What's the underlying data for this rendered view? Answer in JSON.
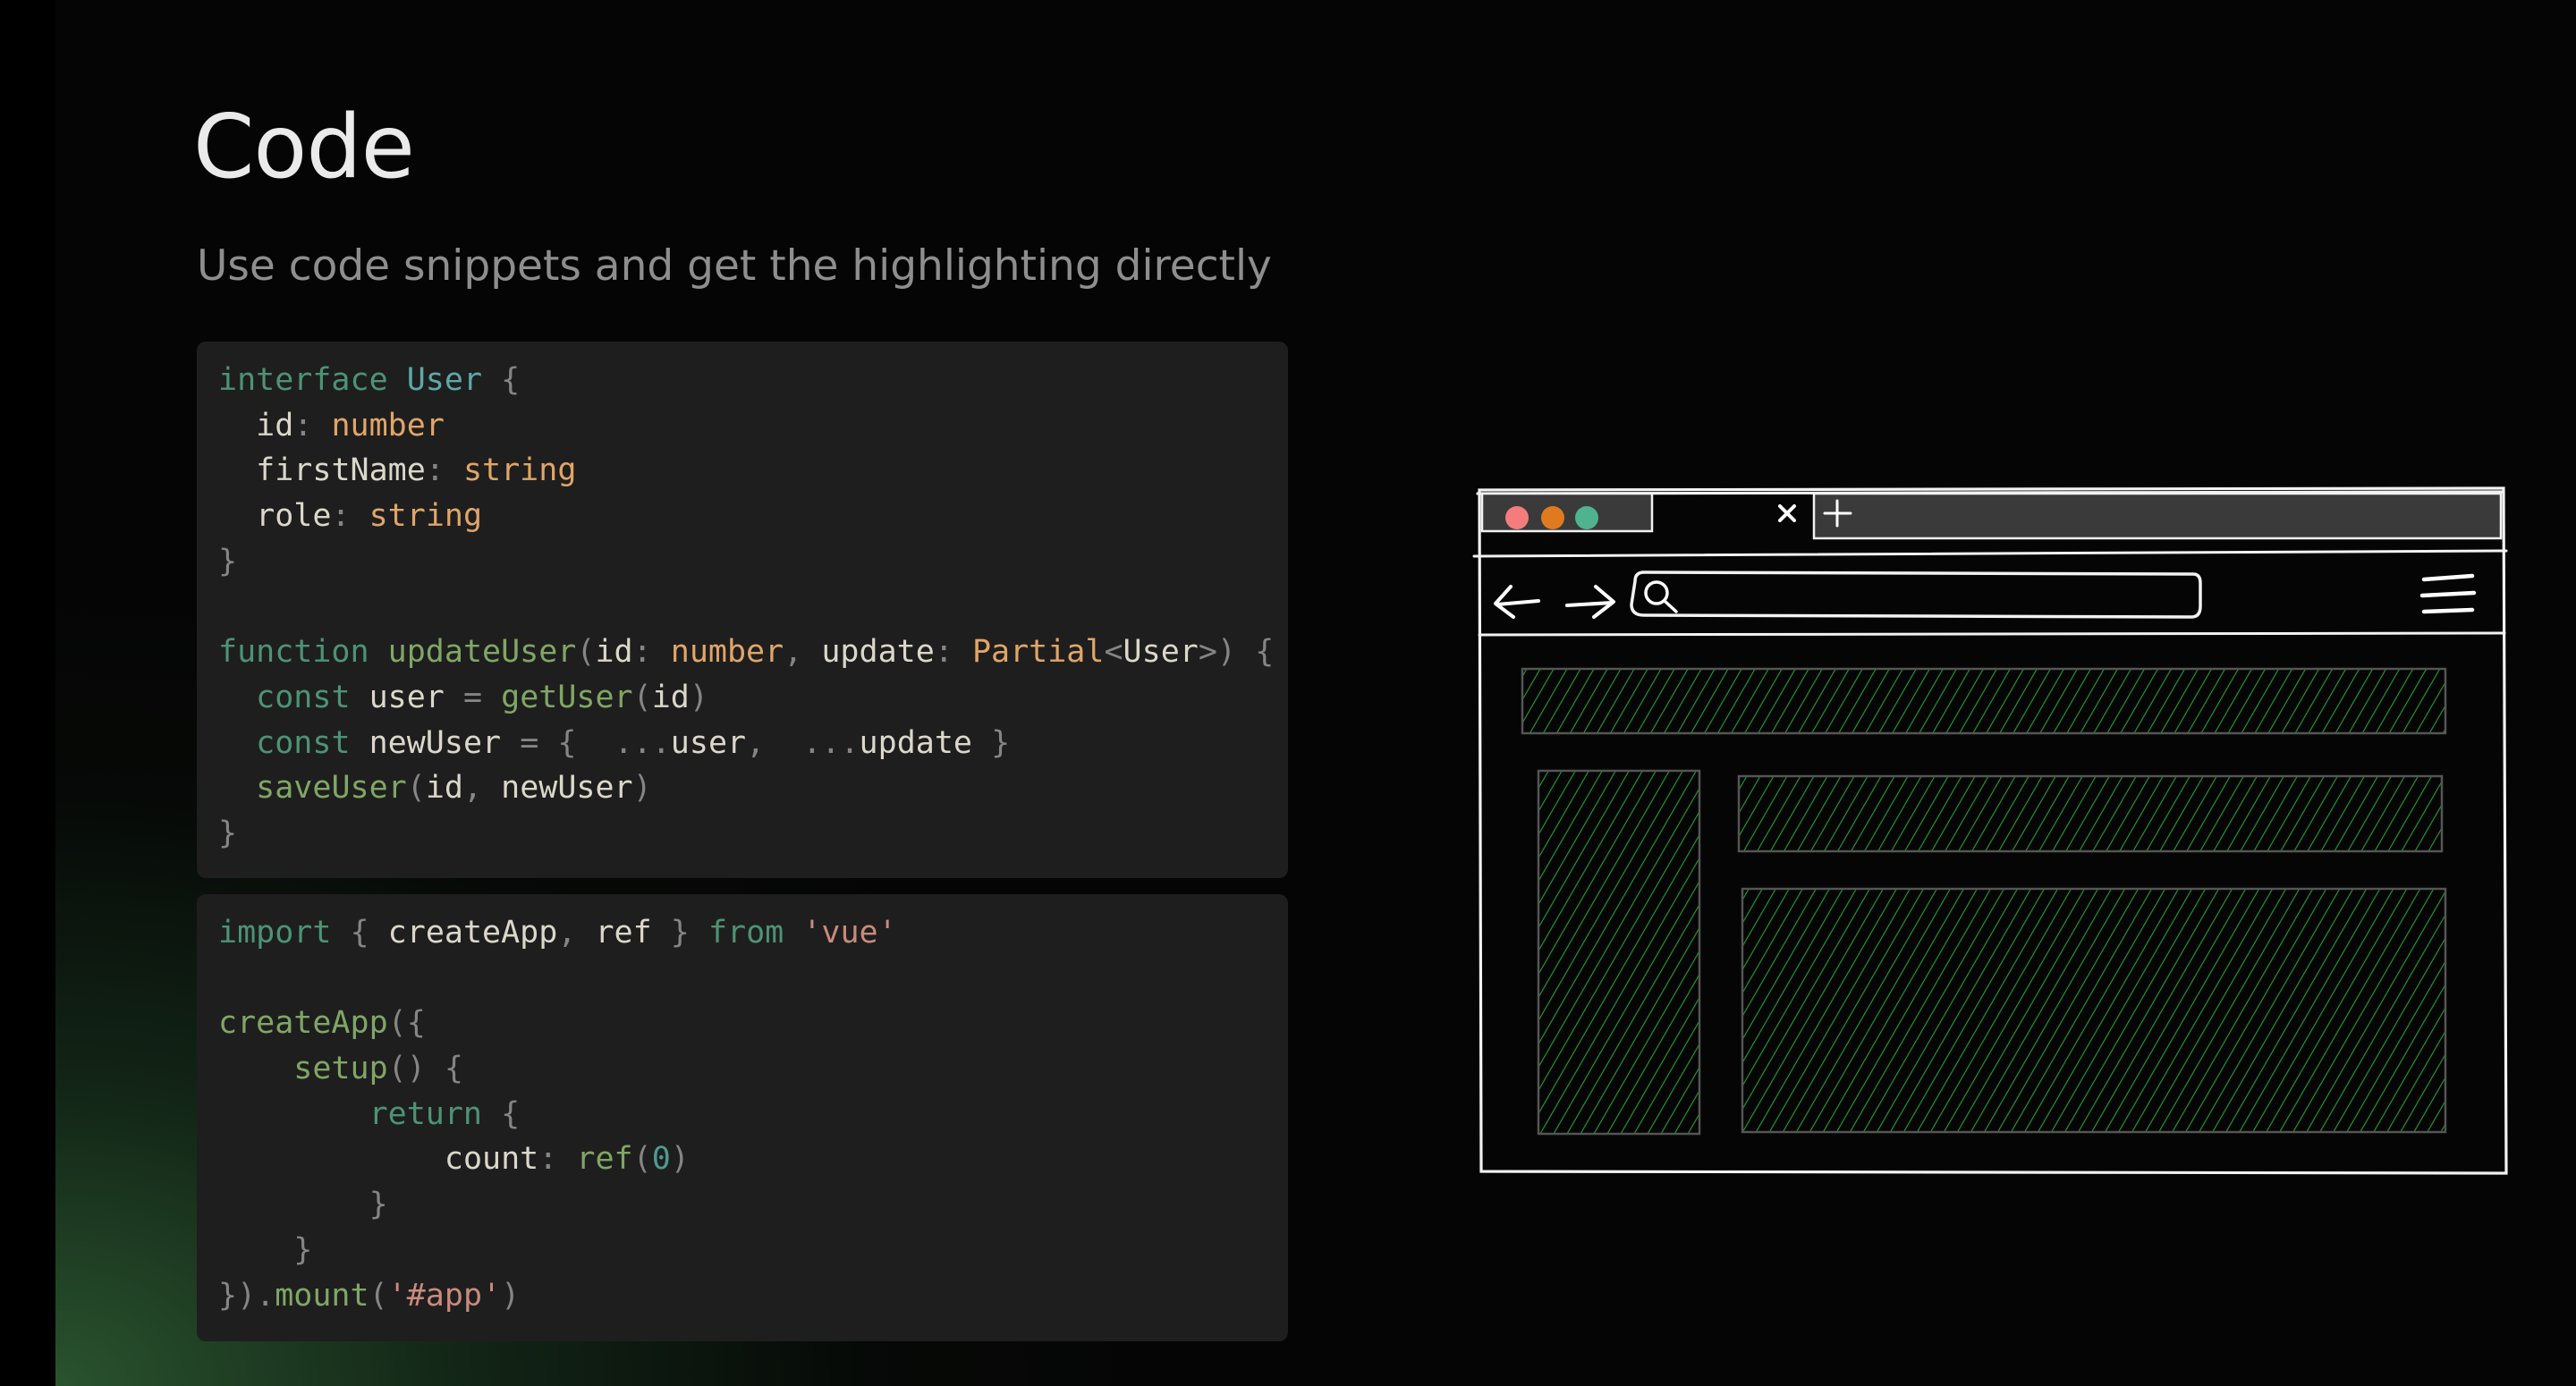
{
  "slide": {
    "title": "Code",
    "subtitle": "Use code snippets and get the highlighting directly"
  },
  "code_blocks": [
    {
      "language": "typescript",
      "lines": [
        [
          [
            "keyword",
            "interface"
          ],
          [
            "plain",
            " "
          ],
          [
            "type",
            "User"
          ],
          [
            "plain",
            " "
          ],
          [
            "punct",
            "{"
          ]
        ],
        [
          [
            "plain",
            "  "
          ],
          [
            "var",
            "id"
          ],
          [
            "punct",
            ":"
          ],
          [
            "plain",
            " "
          ],
          [
            "builtin",
            "number"
          ]
        ],
        [
          [
            "plain",
            "  "
          ],
          [
            "var",
            "firstName"
          ],
          [
            "punct",
            ":"
          ],
          [
            "plain",
            " "
          ],
          [
            "builtin",
            "string"
          ]
        ],
        [
          [
            "plain",
            "  "
          ],
          [
            "var",
            "role"
          ],
          [
            "punct",
            ":"
          ],
          [
            "plain",
            " "
          ],
          [
            "builtin",
            "string"
          ]
        ],
        [
          [
            "punct",
            "}"
          ]
        ],
        [],
        [
          [
            "keyword",
            "function"
          ],
          [
            "plain",
            " "
          ],
          [
            "func",
            "updateUser"
          ],
          [
            "punct",
            "("
          ],
          [
            "var",
            "id"
          ],
          [
            "punct",
            ":"
          ],
          [
            "plain",
            " "
          ],
          [
            "builtin",
            "number"
          ],
          [
            "punct",
            ","
          ],
          [
            "plain",
            " "
          ],
          [
            "var",
            "update"
          ],
          [
            "punct",
            ":"
          ],
          [
            "plain",
            " "
          ],
          [
            "builtin",
            "Partial"
          ],
          [
            "punct",
            "<"
          ],
          [
            "var",
            "User"
          ],
          [
            "punct",
            ">)"
          ],
          [
            "plain",
            " "
          ],
          [
            "punct",
            "{"
          ]
        ],
        [
          [
            "plain",
            "  "
          ],
          [
            "keyword",
            "const"
          ],
          [
            "plain",
            " "
          ],
          [
            "var",
            "user"
          ],
          [
            "plain",
            " "
          ],
          [
            "punct",
            "="
          ],
          [
            "plain",
            " "
          ],
          [
            "func",
            "getUser"
          ],
          [
            "punct",
            "("
          ],
          [
            "var",
            "id"
          ],
          [
            "punct",
            ")"
          ]
        ],
        [
          [
            "plain",
            "  "
          ],
          [
            "keyword",
            "const"
          ],
          [
            "plain",
            " "
          ],
          [
            "var",
            "newUser"
          ],
          [
            "plain",
            " "
          ],
          [
            "punct",
            "="
          ],
          [
            "plain",
            " "
          ],
          [
            "punct",
            "{"
          ],
          [
            "plain",
            "  "
          ],
          [
            "punct",
            "..."
          ],
          [
            "var",
            "user"
          ],
          [
            "punct",
            ","
          ],
          [
            "plain",
            "  "
          ],
          [
            "punct",
            "..."
          ],
          [
            "var",
            "update"
          ],
          [
            "plain",
            " "
          ],
          [
            "punct",
            "}"
          ]
        ],
        [
          [
            "plain",
            "  "
          ],
          [
            "func",
            "saveUser"
          ],
          [
            "punct",
            "("
          ],
          [
            "var",
            "id"
          ],
          [
            "punct",
            ","
          ],
          [
            "plain",
            " "
          ],
          [
            "var",
            "newUser"
          ],
          [
            "punct",
            ")"
          ]
        ],
        [
          [
            "punct",
            "}"
          ]
        ]
      ]
    },
    {
      "language": "javascript",
      "lines": [
        [
          [
            "keyword",
            "import"
          ],
          [
            "plain",
            " "
          ],
          [
            "punct",
            "{"
          ],
          [
            "plain",
            " "
          ],
          [
            "var",
            "createApp"
          ],
          [
            "punct",
            ","
          ],
          [
            "plain",
            " "
          ],
          [
            "var",
            "ref"
          ],
          [
            "plain",
            " "
          ],
          [
            "punct",
            "}"
          ],
          [
            "plain",
            " "
          ],
          [
            "keyword",
            "from"
          ],
          [
            "plain",
            " "
          ],
          [
            "string",
            "'vue'"
          ]
        ],
        [],
        [
          [
            "func",
            "createApp"
          ],
          [
            "punct",
            "({"
          ]
        ],
        [
          [
            "plain",
            "    "
          ],
          [
            "func",
            "setup"
          ],
          [
            "punct",
            "()"
          ],
          [
            "plain",
            " "
          ],
          [
            "punct",
            "{"
          ]
        ],
        [
          [
            "plain",
            "        "
          ],
          [
            "keyword",
            "return"
          ],
          [
            "plain",
            " "
          ],
          [
            "punct",
            "{"
          ]
        ],
        [
          [
            "plain",
            "            "
          ],
          [
            "var",
            "count"
          ],
          [
            "punct",
            ":"
          ],
          [
            "plain",
            " "
          ],
          [
            "func",
            "ref"
          ],
          [
            "punct",
            "("
          ],
          [
            "number",
            "0"
          ],
          [
            "punct",
            ")"
          ]
        ],
        [
          [
            "plain",
            "        "
          ],
          [
            "punct",
            "}"
          ]
        ],
        [
          [
            "plain",
            "    "
          ],
          [
            "punct",
            "}"
          ]
        ],
        [
          [
            "punct",
            "})."
          ],
          [
            "func",
            "mount"
          ],
          [
            "punct",
            "("
          ],
          [
            "string",
            "'#app'"
          ],
          [
            "punct",
            ")"
          ]
        ]
      ]
    }
  ],
  "browser_sketch": {
    "icons": [
      "close-icon",
      "plus-icon",
      "back-arrow-icon",
      "forward-arrow-icon",
      "search-icon",
      "hamburger-menu-icon"
    ],
    "traffic_light_colors": [
      "#f47c7c",
      "#e07a1f",
      "#4fb38f"
    ],
    "hatch_color": "#23a033",
    "stroke_color": "#f2f2f2",
    "tab_fill": "#3a3a3a"
  }
}
